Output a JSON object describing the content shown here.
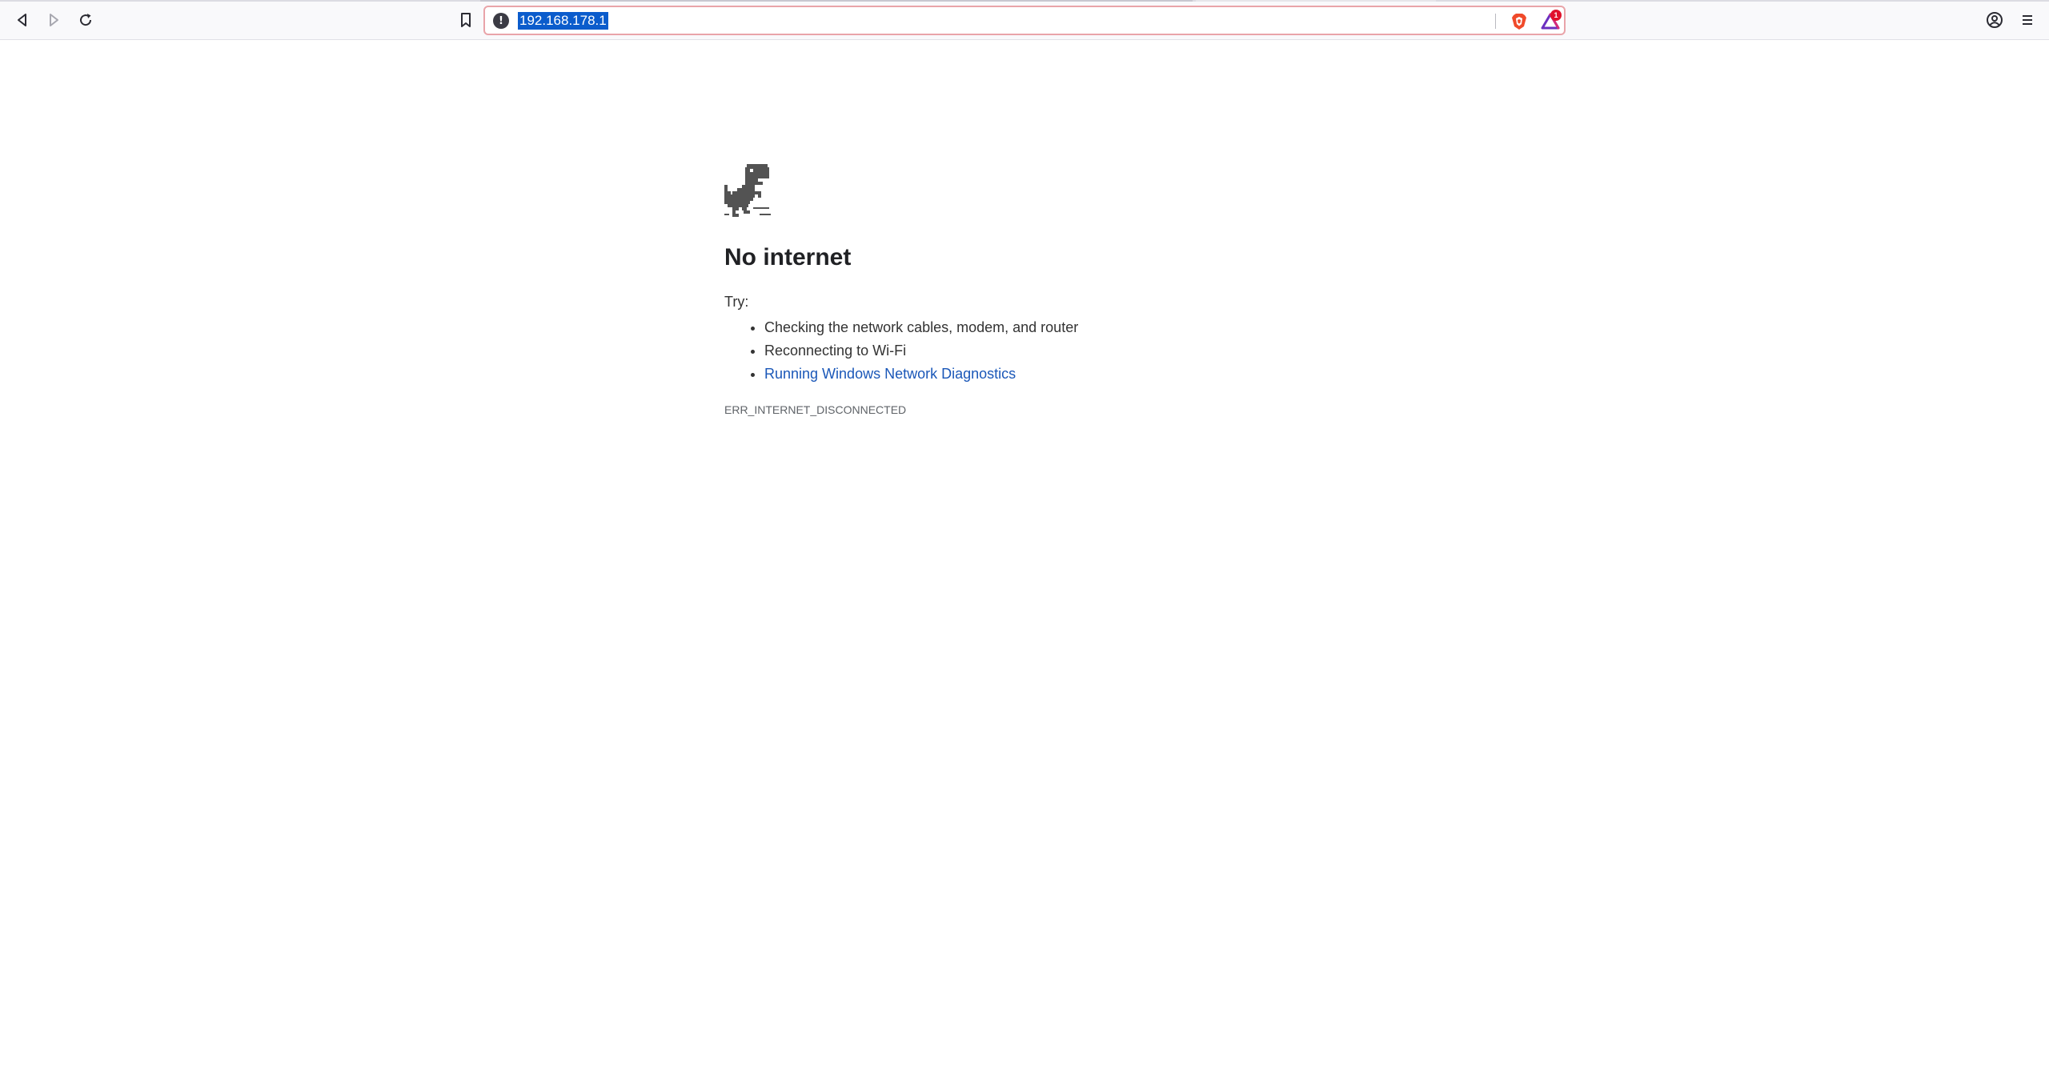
{
  "toolbar": {
    "back_icon": "back-arrow-icon",
    "forward_icon": "forward-arrow-icon",
    "reload_icon": "reload-icon",
    "bookmark_icon": "bookmark-icon",
    "profile_icon": "profile-icon",
    "menu_icon": "hamburger-menu-icon"
  },
  "urlbar": {
    "url": "192.168.178.1",
    "security_icon": "info-warning-icon",
    "shields_icon": "brave-shields-icon",
    "rewards_icon": "brave-rewards-icon",
    "rewards_badge": "1"
  },
  "error_page": {
    "icon": "offline-dinosaur-icon",
    "heading": "No internet",
    "try_label": "Try:",
    "suggestions": [
      "Checking the network cables, modem, and router",
      "Reconnecting to Wi-Fi"
    ],
    "diagnostics_link": "Running Windows Network Diagnostics",
    "error_code": "ERR_INTERNET_DISCONNECTED"
  },
  "colors": {
    "urlbar_border": "#e9a4a9",
    "selection": "#0b5ccc",
    "link": "#1a57b8",
    "badge": "#e0112b"
  }
}
